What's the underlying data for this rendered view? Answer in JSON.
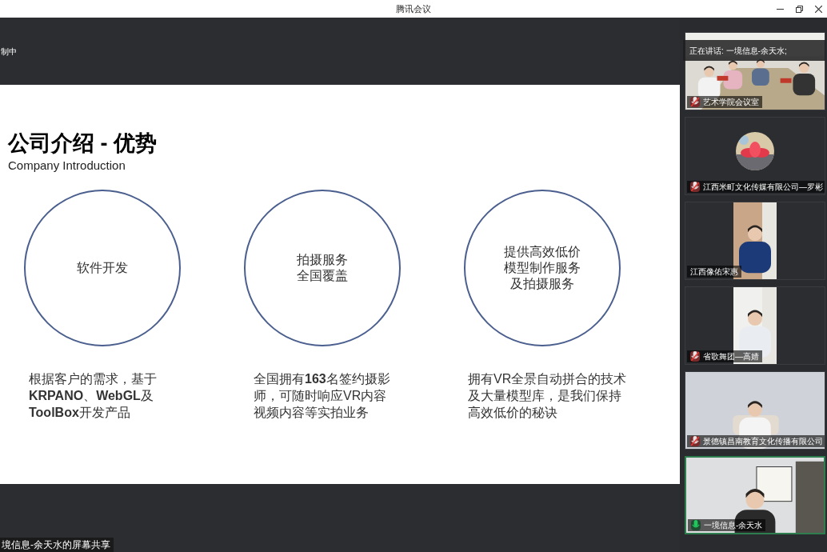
{
  "window": {
    "title": "腾讯会议"
  },
  "recording": {
    "label": "制中"
  },
  "slide": {
    "title": "公司介绍 - 优势",
    "subtitle": "Company Introduction",
    "features": [
      {
        "circle": [
          "软件开发"
        ],
        "description": "根据客户的需求，基于**KRPANO**、**WebGL**及**ToolBox**开发产品"
      },
      {
        "circle": [
          "拍摄服务",
          "全国覆盖"
        ],
        "description": "全国拥有**163**名签约摄影师，可随时响应VR内容视频内容等实拍业务"
      },
      {
        "circle": [
          "提供高效低价",
          "模型制作服务",
          "及拍摄服务"
        ],
        "description": "拥有VR全景自动拼合的技术及大量模型库，是我们保持高效低价的秘诀"
      }
    ]
  },
  "share_label": "境信息-余天水的屏幕共享",
  "speaking": {
    "label": "正在讲话: 一境信息-余天水;"
  },
  "participants": [
    {
      "name": "艺术学院会议室",
      "kind": "room",
      "mic_shown": true,
      "mic_muted": true,
      "active": false
    },
    {
      "name": "江西米町文化传媒有限公司—罗彬",
      "kind": "avatar",
      "mic_shown": true,
      "mic_muted": true,
      "active": false
    },
    {
      "name": "江西像佑宋惠",
      "kind": "portrait",
      "mic_shown": false,
      "active": false
    },
    {
      "name": "省歌舞团—高婧",
      "kind": "portrait",
      "mic_shown": true,
      "mic_muted": true,
      "active": false
    },
    {
      "name": "景德镇昌南教育文化传播有限公司",
      "kind": "wide",
      "mic_shown": true,
      "mic_muted": true,
      "active": false
    },
    {
      "name": "一境信息-余天水",
      "kind": "wide",
      "mic_shown": true,
      "mic_muted": false,
      "active": true
    }
  ]
}
